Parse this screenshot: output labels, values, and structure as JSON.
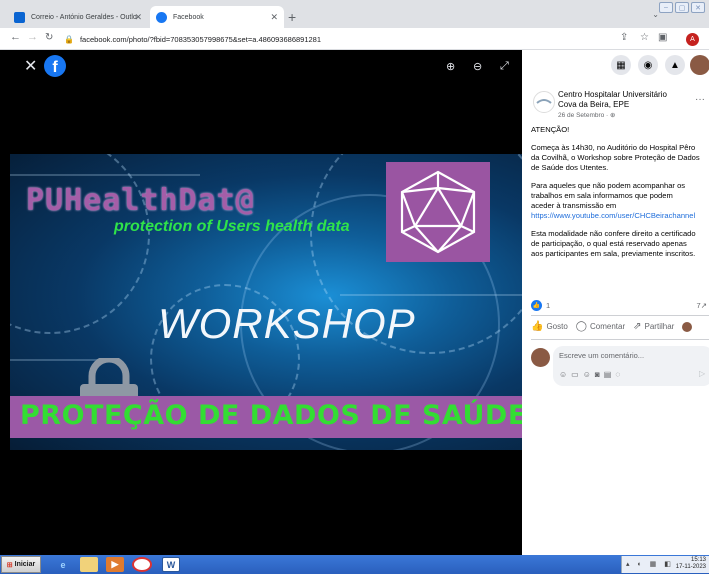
{
  "browser": {
    "tabs": [
      {
        "title": "Correio - António Geraldes - Outlo",
        "favicon": "outlook-icon",
        "active": false
      },
      {
        "title": "Facebook",
        "favicon": "facebook-icon",
        "active": true
      }
    ],
    "new_tab_icon": "plus-icon",
    "url": "facebook.com/photo/?fbid=708353057998675&set=a.486093686891281",
    "profile_initial": "A"
  },
  "viewer": {
    "banner": {
      "title": "PUHealthDat@",
      "subtitle": "protection of Users health data",
      "headline": "WORKSHOP",
      "stripe": "PROTEÇÃO DE DADOS DE SAÚDE"
    }
  },
  "post": {
    "author": "Centro Hospitalar Universitário Cova da Beira, EPE",
    "date": "26 de Setembro · ",
    "heading": "ATENÇÃO!",
    "paragraphs": [
      "Começa às 14h30, no Auditório do Hospital Pêro",
      "da Covilhã, o Workshop sobre Proteção de Dados",
      "de Saúde dos Utentes.",
      "Para aqueles que não podem acompanhar os",
      "trabalhos em sala informamos que podem",
      "aceder à transmissão em",
      "https://www.youtube.com/user/CHCBeirachannel",
      "Esta modalidade não confere direito a certificado",
      "de participação, o qual está reservado apenas",
      "aos participantes em sala, previamente inscritos."
    ],
    "likes": "1",
    "shares": "7",
    "actions": {
      "like": "Gosto",
      "comment": "Comentar",
      "share": "Partilhar"
    },
    "comment_placeholder": "Escreve um comentário..."
  },
  "taskbar": {
    "start_label": "Iniciar",
    "time": "15:13",
    "date": "17-11-2023"
  },
  "colors": {
    "facebook_blue": "#1877f2",
    "banner_purple": "#9b59a6",
    "banner_green": "#33dd33"
  }
}
